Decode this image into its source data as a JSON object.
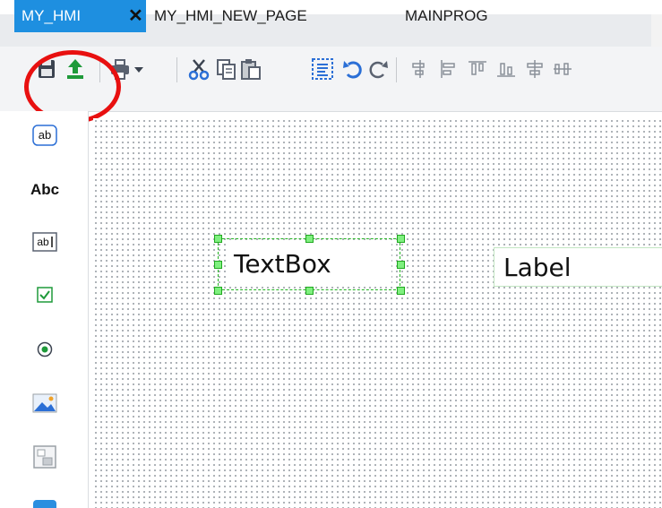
{
  "tabs": [
    {
      "label": "MY_HMI",
      "active": true
    },
    {
      "label": "MY_HMI_NEW_PAGE",
      "active": false
    },
    {
      "label": "MAINPROG",
      "active": false
    }
  ],
  "tab_close_glyph": "✕",
  "toolbar": {
    "buttons": [
      "save-icon",
      "upload-icon",
      "print-icon",
      "dropdown-arrow-icon",
      "cut-icon",
      "copy-icon",
      "paste-icon",
      "select-all-icon",
      "undo-icon",
      "redo-icon",
      "align-left-icon",
      "align-center-icon",
      "align-top-icon",
      "align-bottom-icon",
      "align-middle-icon",
      "distribute-icon"
    ]
  },
  "toolbox": {
    "items": [
      "textbox-tool-icon",
      "label-tool",
      "input-tool-icon",
      "checkbox-tool-icon",
      "radio-tool-icon",
      "image-tool-icon",
      "panel-tool-icon",
      "button-tool-icon"
    ],
    "label_tool_text": "Abc",
    "textbox_tool_text": "ab"
  },
  "canvas": {
    "textbox_text": "TextBox",
    "label_text": "Label"
  },
  "colors": {
    "active_tab": "#1e8fe0",
    "highlight": "#e81010",
    "selection": "#23b523",
    "upload_green": "#1f9a3a"
  }
}
